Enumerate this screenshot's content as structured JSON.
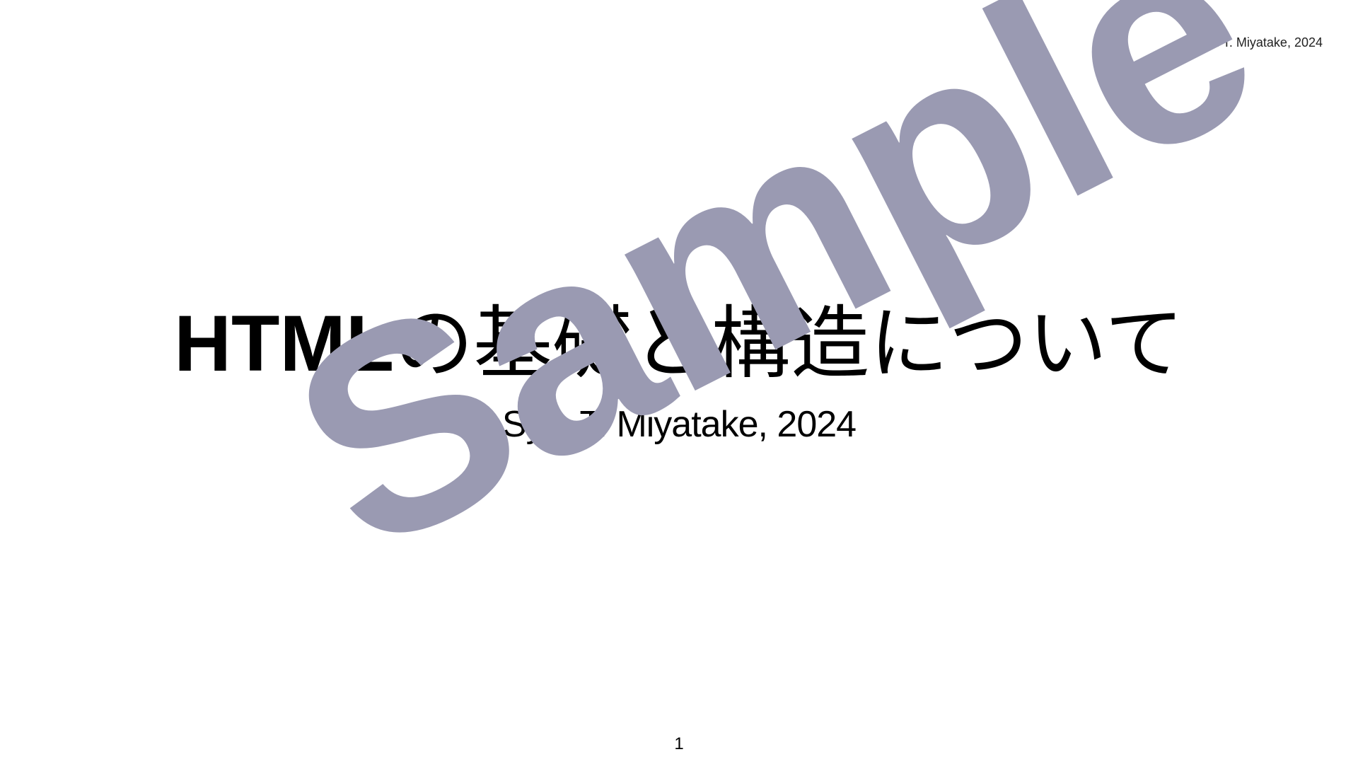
{
  "slide": {
    "header_author": "Sys. T. Miyatake, 2024",
    "watermark_text": "Sample",
    "title_latin": "HTML",
    "title_japanese": "の基礎と構造について",
    "subtitle": "Sys. T. Miyatake, 2024",
    "page_number": "1"
  },
  "colors": {
    "background": "#ffffff",
    "text": "#000000",
    "watermark": "#9a9ab2"
  }
}
